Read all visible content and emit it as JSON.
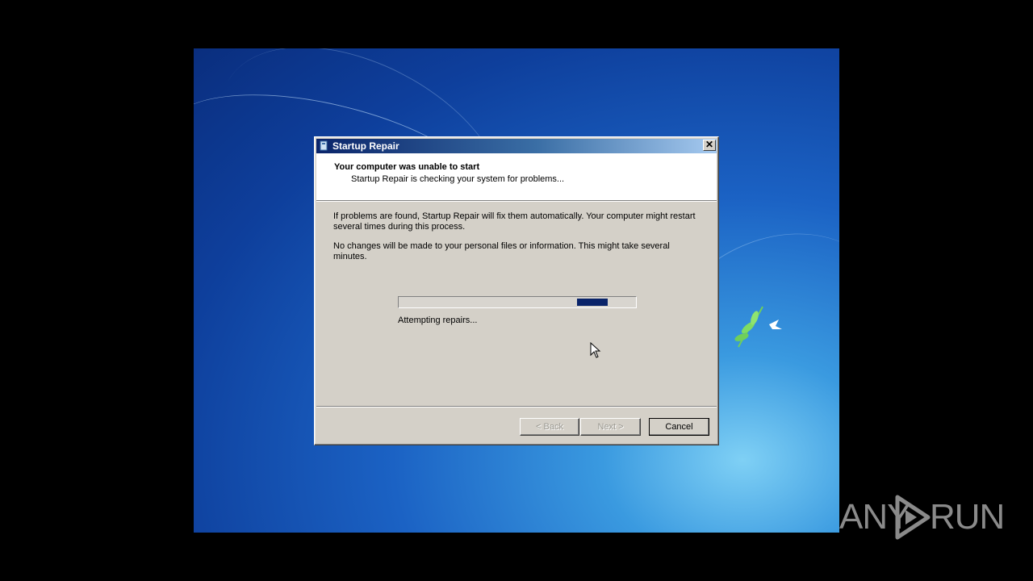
{
  "window": {
    "title": "Startup Repair",
    "close_glyph": "✕"
  },
  "header": {
    "title": "Your computer was unable to start",
    "subtitle": "Startup Repair is checking your system for problems..."
  },
  "body": {
    "paragraph1": "If problems are found, Startup Repair will fix them automatically. Your computer might restart several times during this process.",
    "paragraph2": "No changes will be made to your personal files or information. This might take several minutes."
  },
  "progress": {
    "mode": "marquee",
    "block_start_fraction": 0.75,
    "block_end_fraction": 0.88,
    "status_text": "Attempting repairs..."
  },
  "buttons": {
    "back_label": "< Back",
    "next_label": "Next >",
    "cancel_label": "Cancel"
  },
  "watermark": {
    "left_text": "ANY",
    "right_text": "RUN"
  },
  "colors": {
    "progress_block": "#0a246a",
    "title_bar_start": "#0a246a",
    "dialog_face": "#d4d0c8"
  }
}
